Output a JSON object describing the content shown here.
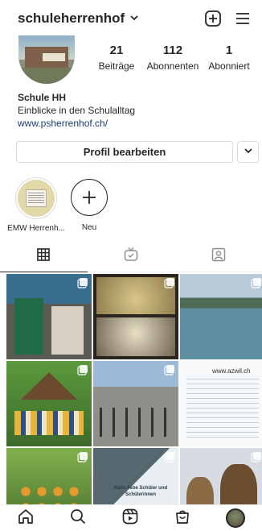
{
  "header": {
    "username": "schuleherrenhof",
    "icons": [
      "chevron-down-icon",
      "add-post-icon",
      "menu-icon"
    ]
  },
  "stats": [
    {
      "value": "21",
      "label": "Beiträge"
    },
    {
      "value": "112",
      "label": "Abonnenten"
    },
    {
      "value": "1",
      "label": "Abonniert"
    }
  ],
  "bio": {
    "name": "Schule HH",
    "description": "Einblicke in den Schulalltag",
    "link": "www.psherrenhof.ch/"
  },
  "buttons": {
    "edit_profile": "Profil bearbeiten"
  },
  "highlights": [
    {
      "label": "EMW Herrenh..."
    },
    {
      "label": "Neu"
    }
  ],
  "grid_posts": [
    {
      "badge": "multiple-icon"
    },
    {
      "badge": "multiple-icon"
    },
    {
      "badge": "multiple-icon"
    },
    {
      "badge": "multiple-icon"
    },
    {
      "badge": "multiple-icon"
    },
    {
      "header": "www.azwil.ch"
    },
    {
      "badge": "multiple-icon"
    },
    {
      "text": "Hallo liebe Schüler und Schülerinnen",
      "badge": "multiple-icon"
    },
    {
      "badge": "multiple-icon"
    }
  ],
  "colors": {
    "text": "#262626",
    "link": "#1a3b6b",
    "border": "#dbdbdb"
  }
}
